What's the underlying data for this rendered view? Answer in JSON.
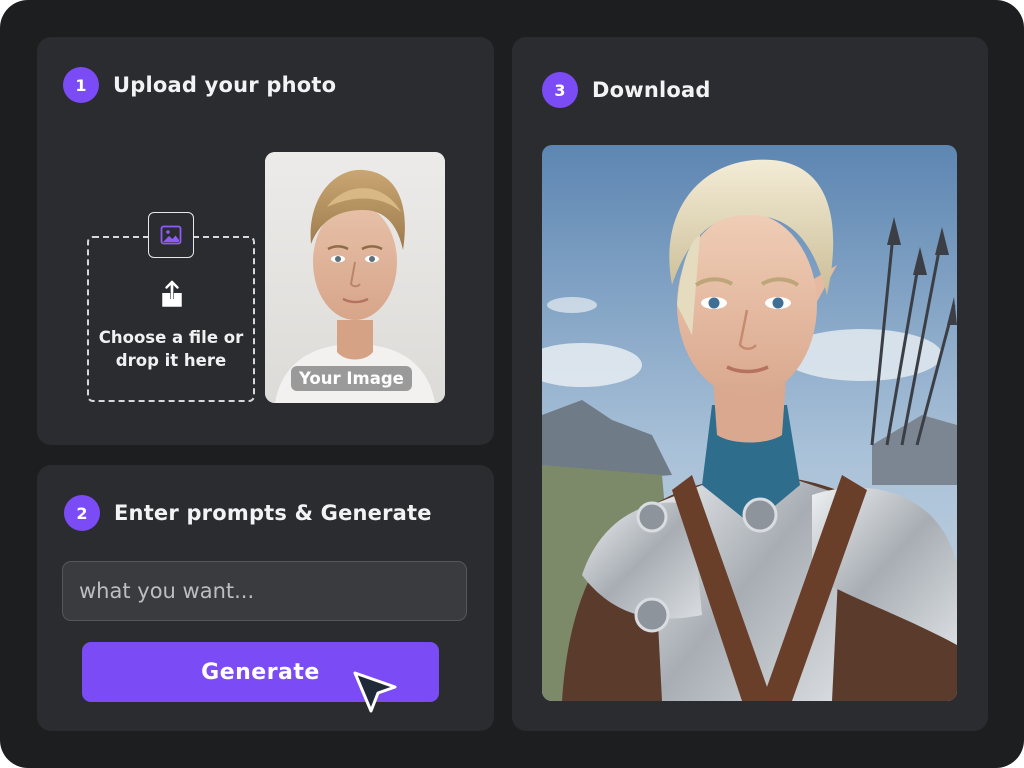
{
  "steps": {
    "upload": {
      "number": "1",
      "title": "Upload your photo"
    },
    "prompt": {
      "number": "2",
      "title": "Enter prompts & Generate"
    },
    "download": {
      "number": "3",
      "title": "Download"
    }
  },
  "upload": {
    "dropzone_line1": "Choose a file or",
    "dropzone_line2": "drop it here",
    "preview_label": "Your Image",
    "icons": [
      "image-icon",
      "upload-icon"
    ]
  },
  "prompt": {
    "placeholder": "what you want...",
    "generate_label": "Generate"
  },
  "colors": {
    "accent": "#7b4cf6",
    "background": "#1d1e20",
    "card": "#2b2c2f"
  }
}
